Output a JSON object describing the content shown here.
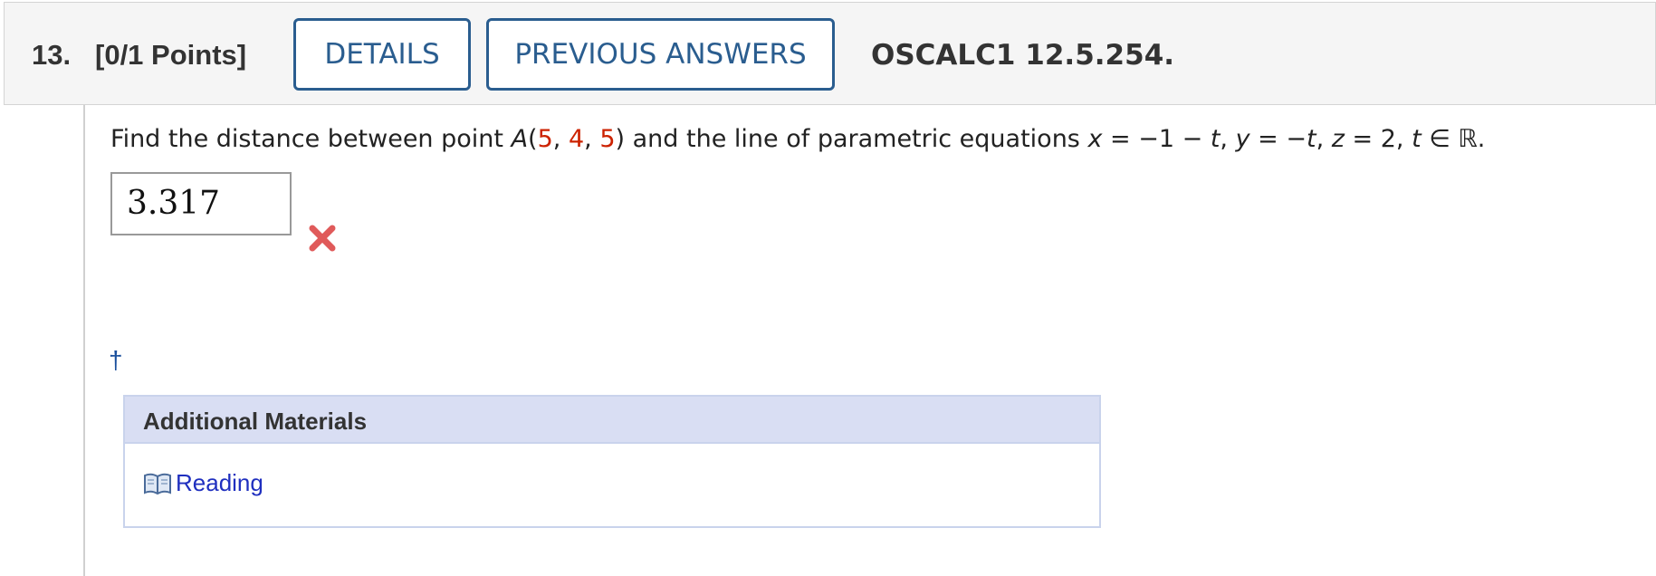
{
  "question": {
    "number": "13.",
    "points": "[0/1 Points]",
    "details_label": "DETAILS",
    "previous_answers_label": "PREVIOUS ANSWERS",
    "code": "OSCALC1 12.5.254."
  },
  "problem": {
    "prefix": "Find the distance between point ",
    "point_name": "A",
    "open_paren": "(",
    "coord_x": "5",
    "comma1": ", ",
    "coord_y": "4",
    "comma2": ", ",
    "coord_z": "5",
    "close_paren": ")",
    "middle": " and the line of parametric equations ",
    "var_x": "x",
    "eq_x": " = −1 − ",
    "var_t1": "t",
    "sep1": ", ",
    "var_y": "y",
    "eq_y": " = −",
    "var_t2": "t",
    "sep2": ", ",
    "var_z": "z",
    "eq_z": " = 2, ",
    "var_t3": "t",
    "in_reals": " ∈ ℝ."
  },
  "answer": {
    "value": "3.317",
    "status": "incorrect"
  },
  "footnote_symbol": "†",
  "additional_materials": {
    "title": "Additional Materials",
    "reading_label": "Reading",
    "icon": "book-icon"
  },
  "colors": {
    "accent_blue": "#2a5d8f",
    "coordinate_red": "#cc2200",
    "incorrect_red": "#e05a5a",
    "link_blue": "#1f2fbf",
    "panel_header": "#d9def3"
  }
}
